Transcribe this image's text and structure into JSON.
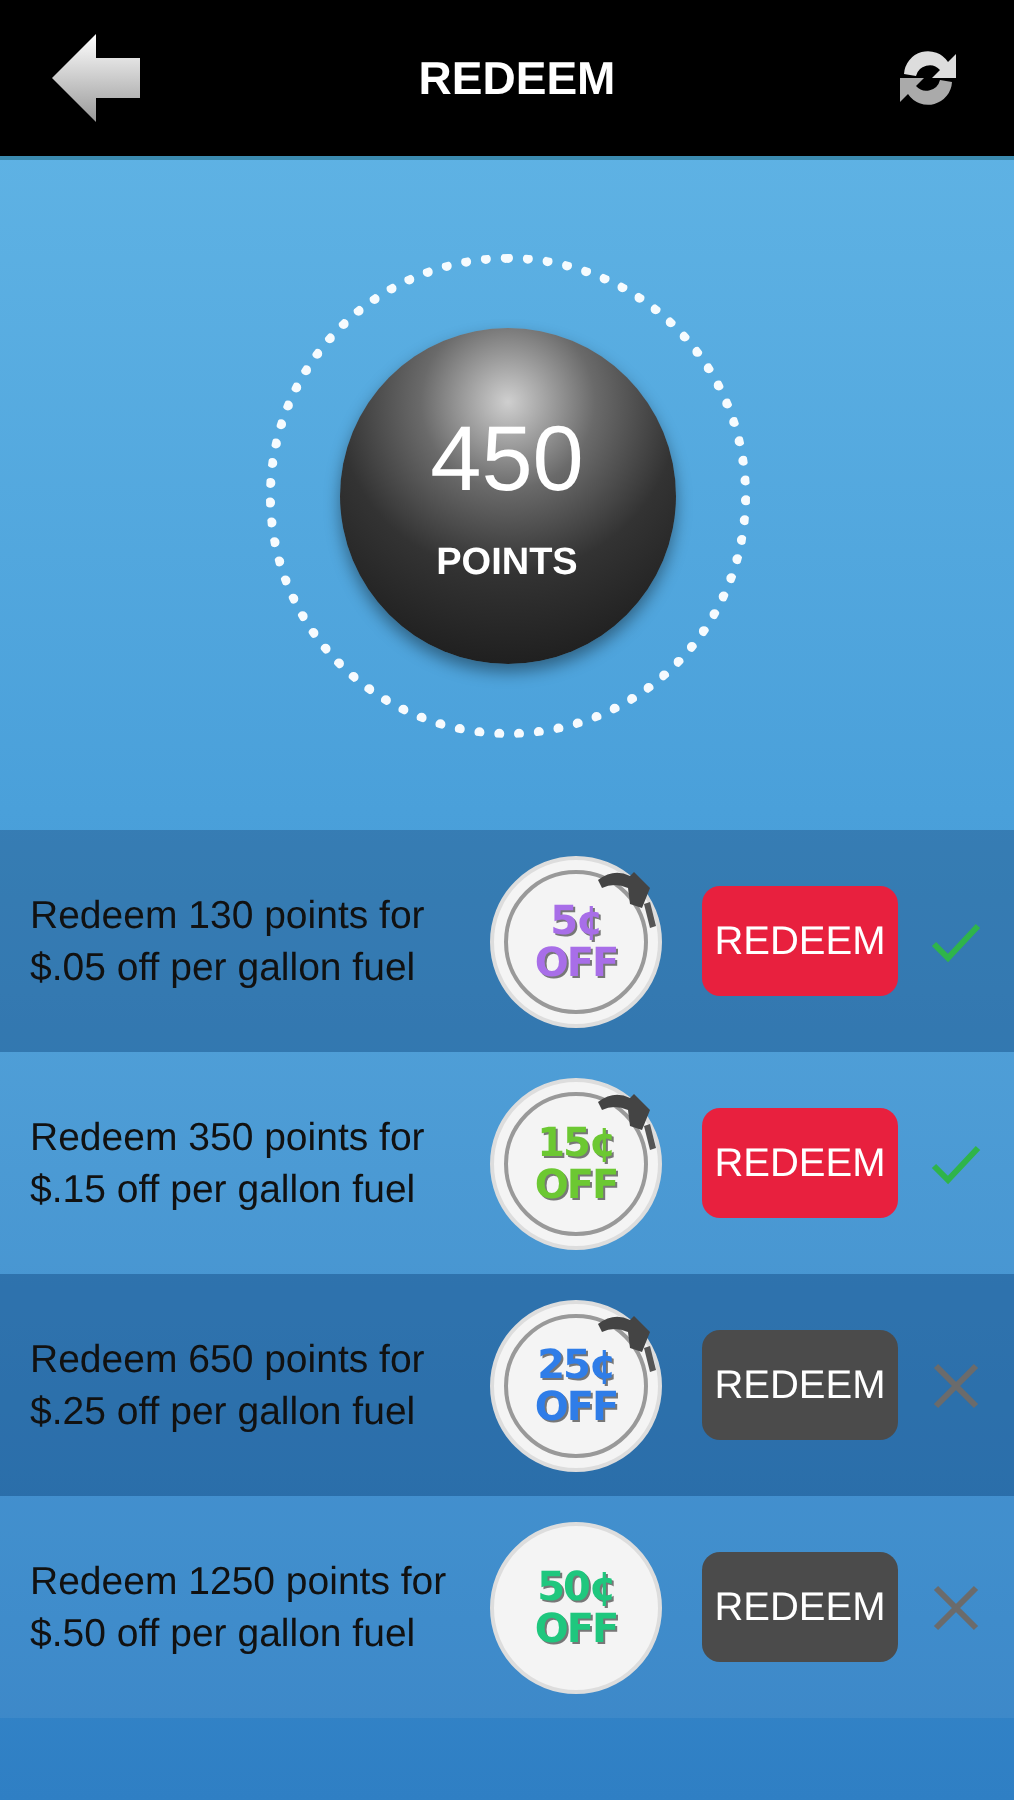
{
  "header": {
    "title": "REDEEM"
  },
  "points": {
    "value": "450",
    "label": "POINTS"
  },
  "offers": [
    {
      "text": "Redeem 130 points for $.05 off per gallon fuel",
      "coupon": {
        "amount": "5¢",
        "off": "OFF",
        "color": "#a86ee8",
        "nozzle": true
      },
      "available": true,
      "button": "REDEEM"
    },
    {
      "text": "Redeem 350 points for $.15 off per gallon fuel",
      "coupon": {
        "amount": "15¢",
        "off": "OFF",
        "color": "#6cc832",
        "nozzle": true
      },
      "available": true,
      "button": "REDEEM"
    },
    {
      "text": "Redeem 650 points for $.25 off per gallon fuel",
      "coupon": {
        "amount": "25¢",
        "off": "OFF",
        "color": "#2f7de8",
        "nozzle": true
      },
      "available": false,
      "button": "REDEEM"
    },
    {
      "text": "Redeem 1250 points for $.50 off per gallon fuel",
      "coupon": {
        "amount": "50¢",
        "off": "OFF",
        "color": "#1fc77e",
        "nozzle": false
      },
      "available": false,
      "button": "REDEEM"
    }
  ]
}
